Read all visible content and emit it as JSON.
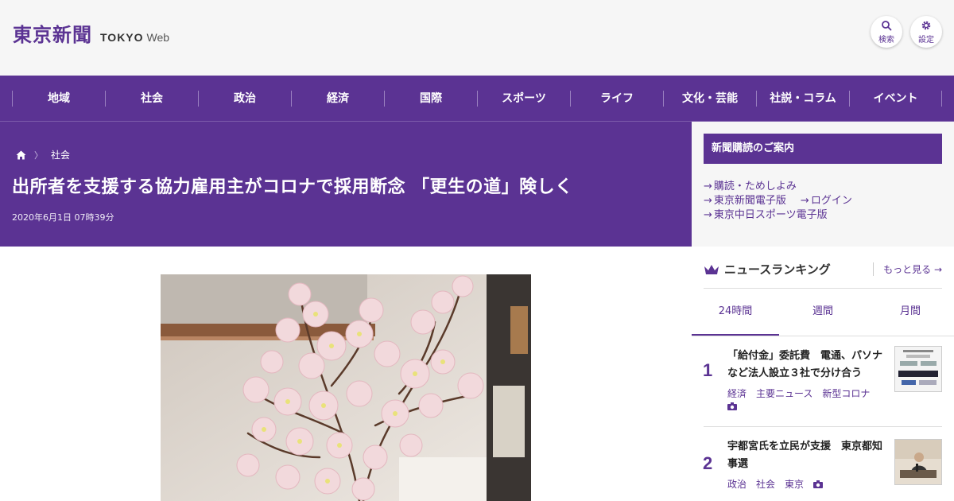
{
  "header": {
    "logo_kanji": "東京新聞",
    "logo_tokyo": "TOKYO",
    "logo_web": "Web",
    "search_label": "検索",
    "settings_label": "設定"
  },
  "nav": {
    "items": [
      "地域",
      "社会",
      "政治",
      "経済",
      "国際",
      "スポーツ",
      "ライフ",
      "文化・芸能",
      "社説・コラム",
      "イベント"
    ]
  },
  "article": {
    "breadcrumb_section": "社会",
    "title": "出所者を支援する協力雇用主がコロナで採用断念 「更生の道」険しく",
    "date": "2020年6月1日 07時39分"
  },
  "sidebar": {
    "subscribe_title": "新聞購読のご案内",
    "links": {
      "trial": "購読・ためしよみ",
      "e_paper": "東京新聞電子版",
      "login": "ログイン",
      "sports": "東京中日スポーツ電子版"
    },
    "ranking": {
      "title": "ニュースランキング",
      "more": "もっと見る",
      "tabs": [
        "24時間",
        "週間",
        "月間"
      ],
      "items": [
        {
          "rank": "1",
          "title": "「給付金」委託費　電通、パソナなど法人設立３社で分け合う",
          "tags": [
            "経済",
            "主要ニュース",
            "新型コロナ"
          ]
        },
        {
          "rank": "2",
          "title": "宇都宮氏を立民が支援　東京都知事選",
          "tags": [
            "政治",
            "社会",
            "東京"
          ]
        }
      ]
    }
  },
  "colors": {
    "brand_purple": "#5b3393"
  }
}
